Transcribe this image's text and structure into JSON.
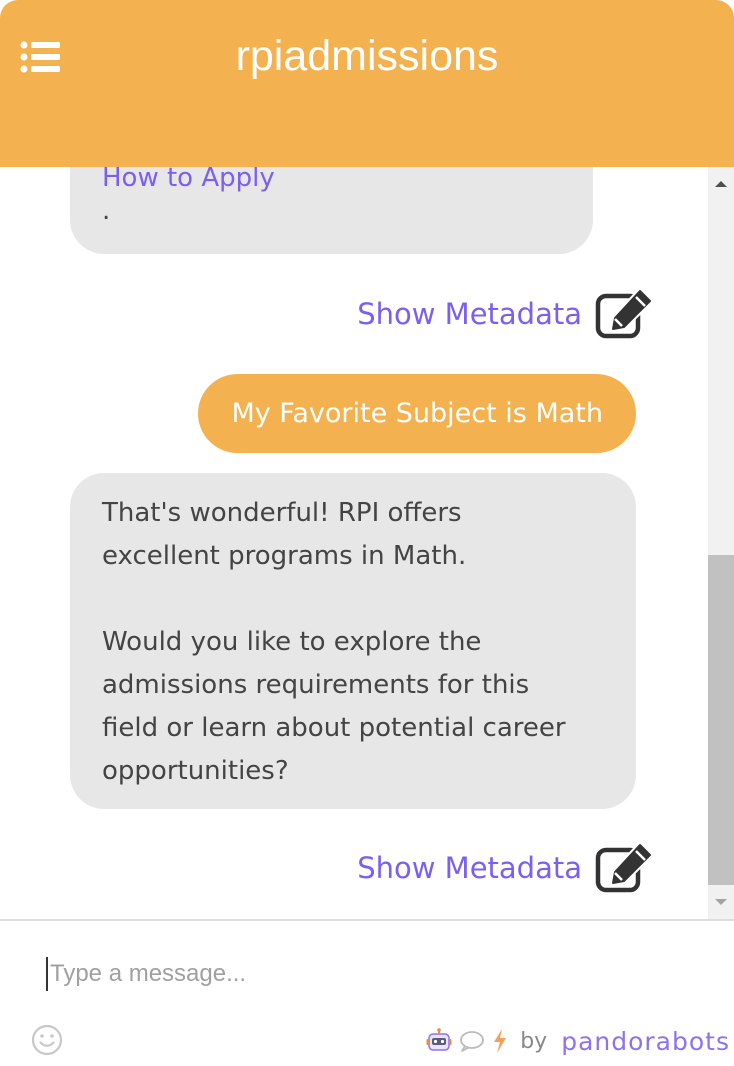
{
  "header": {
    "title": "rpiadmissions",
    "menu_icon": "list-menu-icon",
    "background_color": "#f3b24f"
  },
  "messages": {
    "previous_bot": {
      "link_text": "How to Apply",
      "trailing_text": "."
    },
    "metadata_label": "Show Metadata",
    "metadata_icon": "edit-square-icon",
    "user": {
      "text": "My Favorite Subject is Math"
    },
    "bot_reply": {
      "line1": "That's wonderful! RPI offers",
      "line2": "excellent programs in Math.",
      "line3": "Would you like to explore the",
      "line4": "admissions requirements for this",
      "line5": "field or learn about potential career",
      "line6": "opportunities?"
    }
  },
  "input": {
    "placeholder": "Type a message..."
  },
  "footer": {
    "emoji_icon": "smiley-icon",
    "by_text": "by",
    "brand": "pandorabots",
    "brand_color": "#8e72ee"
  },
  "colors": {
    "accent": "#f3b24f",
    "link": "#7b5ff0",
    "bot_bubble": "#e7e7e7"
  }
}
